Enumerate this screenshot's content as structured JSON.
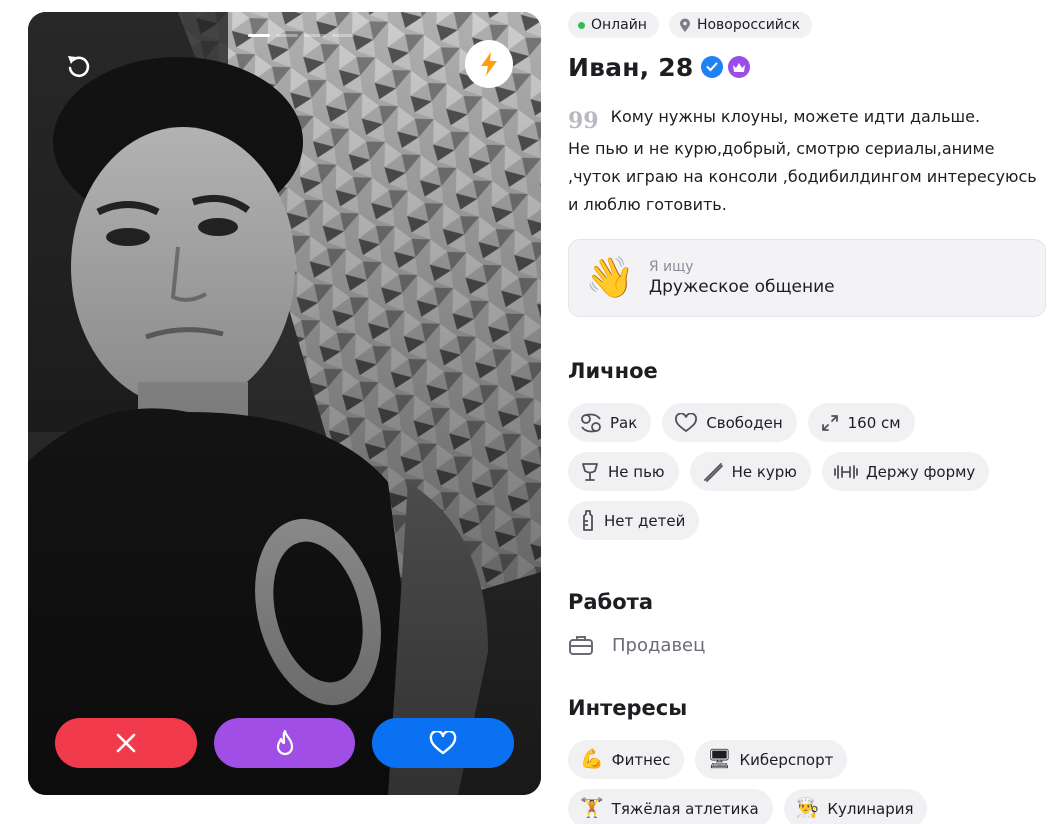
{
  "photo": {
    "alt": "profile-photo",
    "pager_count": 4,
    "pager_active": 0
  },
  "actions": {
    "dislike_icon": "close-icon",
    "super_icon": "flame-icon",
    "like_icon": "heart-icon"
  },
  "status": {
    "online": "Онлайн",
    "city": "Новороссийск"
  },
  "profile": {
    "name": "Иван, 28",
    "quote_mark": "99",
    "bio_line1": "Кому нужны клоуны, можете идти дальше.",
    "bio_rest": "Не пью и не курю,добрый, смотрю сериалы,аниме ,чуток играю на консоли ,бодибилдингом интересуюсь и люблю готовить."
  },
  "seeking": {
    "label": "Я ищу",
    "value": "Дружеское общение"
  },
  "personal": {
    "title": "Личное",
    "tags": [
      {
        "icon": "zodiac-cancer-icon",
        "label": "Рак"
      },
      {
        "icon": "heart-outline-icon",
        "label": "Свободен"
      },
      {
        "icon": "resize-arrows-icon",
        "label": "160 см"
      },
      {
        "icon": "glass-icon",
        "label": "Не пью"
      },
      {
        "icon": "cigarette-icon",
        "label": "Не курю"
      },
      {
        "icon": "dumbbell-icon",
        "label": "Держу форму"
      },
      {
        "icon": "baby-bottle-icon",
        "label": "Нет детей"
      }
    ]
  },
  "work": {
    "title": "Работа",
    "value": "Продавец"
  },
  "interests": {
    "title": "Интересы",
    "tags": [
      {
        "emoji": "💪",
        "label": "Фитнес"
      },
      {
        "emoji": "🖥",
        "label": "Киберспорт"
      },
      {
        "emoji": "🏋",
        "label": "Тяжёлая атлетика"
      },
      {
        "emoji": "👨‍🍳",
        "label": "Кулинария"
      }
    ]
  },
  "colors": {
    "dislike": "#f23a4d",
    "super": "#a14ee6",
    "like": "#0a72f2",
    "online_dot": "#2fbf54"
  }
}
